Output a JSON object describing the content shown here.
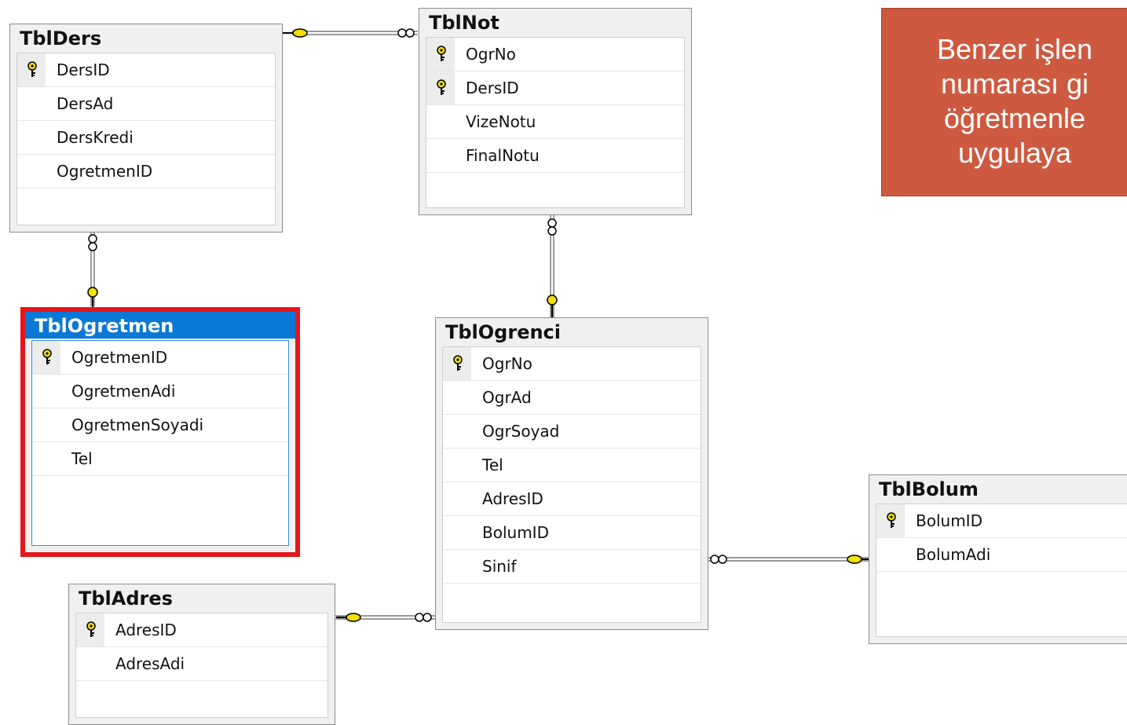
{
  "tables": {
    "ders": {
      "title": "TblDers",
      "columns": [
        {
          "name": "DersID",
          "pk": true
        },
        {
          "name": "DersAd",
          "pk": false
        },
        {
          "name": "DersKredi",
          "pk": false
        },
        {
          "name": "OgretmenID",
          "pk": false
        }
      ]
    },
    "not": {
      "title": "TblNot",
      "columns": [
        {
          "name": "OgrNo",
          "pk": true
        },
        {
          "name": "DersID",
          "pk": true
        },
        {
          "name": "VizeNotu",
          "pk": false
        },
        {
          "name": "FinalNotu",
          "pk": false
        }
      ]
    },
    "ogretmen": {
      "title": "TblOgretmen",
      "selected": true,
      "columns": [
        {
          "name": "OgretmenID",
          "pk": true
        },
        {
          "name": "OgretmenAdi",
          "pk": false
        },
        {
          "name": "OgretmenSoyadi",
          "pk": false
        },
        {
          "name": "Tel",
          "pk": false
        }
      ]
    },
    "ogrenci": {
      "title": "TblOgrenci",
      "columns": [
        {
          "name": "OgrNo",
          "pk": true
        },
        {
          "name": "OgrAd",
          "pk": false
        },
        {
          "name": "OgrSoyad",
          "pk": false
        },
        {
          "name": "Tel",
          "pk": false
        },
        {
          "name": "AdresID",
          "pk": false
        },
        {
          "name": "BolumID",
          "pk": false
        },
        {
          "name": "Sinif",
          "pk": false
        }
      ]
    },
    "adres": {
      "title": "TblAdres",
      "columns": [
        {
          "name": "AdresID",
          "pk": true
        },
        {
          "name": "AdresAdi",
          "pk": false
        }
      ]
    },
    "bolum": {
      "title": "TblBolum",
      "columns": [
        {
          "name": "BolumID",
          "pk": true
        },
        {
          "name": "BolumAdi",
          "pk": false
        }
      ]
    }
  },
  "callout": {
    "lines": [
      "Benzer işlen",
      "numarası gi",
      "öğretmenle",
      "uygulaya"
    ]
  },
  "colors": {
    "key": "#f3e000",
    "selected_border": "#e5161b",
    "selected_header": "#0a78d7",
    "callout_bg": "#cd5a40"
  }
}
